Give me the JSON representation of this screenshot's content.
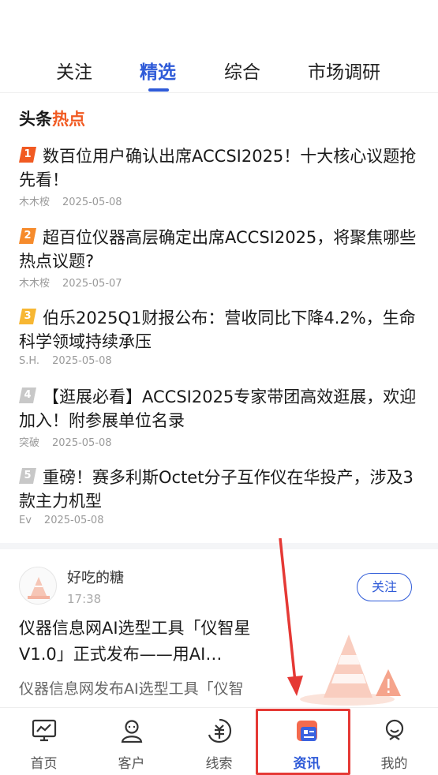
{
  "tabs": [
    {
      "label": "关注"
    },
    {
      "label": "精选",
      "active": true
    },
    {
      "label": "综合"
    },
    {
      "label": "市场调研"
    }
  ],
  "hot": {
    "title_main": "头条",
    "title_accent": "热点",
    "items": [
      {
        "rank": "1",
        "rank_color": "#f15a22",
        "headline": "数百位用户确认出席ACCSI2025！十大核心议题抢先看！",
        "author": "木木桉",
        "date": "2025-05-08"
      },
      {
        "rank": "2",
        "rank_color": "#f68b2c",
        "headline": "超百位仪器高层确定出席ACCSI2025，将聚焦哪些热点议题?",
        "author": "木木桉",
        "date": "2025-05-07"
      },
      {
        "rank": "3",
        "rank_color": "#f7b733",
        "headline": "伯乐2025Q1财报公布：营收同比下降4.2%，生命科学领域持续承压",
        "author": "S.H.",
        "date": "2025-05-08"
      },
      {
        "rank": "4",
        "rank_color": "#c8c8c8",
        "headline": "【逛展必看】ACCSI2025专家带团高效逛展，欢迎加入！附参展单位名录",
        "author": "突破",
        "date": "2025-05-08"
      },
      {
        "rank": "5",
        "rank_color": "#c8c8c8",
        "headline": "重磅！赛多利斯Octet分子互作仪在华投产，涉及3款主力机型",
        "author": "Ev",
        "date": "2025-05-08"
      }
    ]
  },
  "post": {
    "author": "好吃的糖",
    "time": "17:38",
    "follow_label": "关注",
    "title": "仪器信息网AI选型工具「仪智星V1.0」正式发布——用AI…",
    "summary": "仪器信息网发布AI选型工具「仪智"
  },
  "nav": [
    {
      "label": "首页",
      "icon": "home-chart-icon"
    },
    {
      "label": "客户",
      "icon": "customer-icon"
    },
    {
      "label": "线索",
      "icon": "leads-icon"
    },
    {
      "label": "资讯",
      "icon": "news-icon",
      "active": true
    },
    {
      "label": "我的",
      "icon": "profile-icon"
    }
  ],
  "colors": {
    "accent": "#2f5bd8",
    "hot_accent": "#f15a22",
    "highlight": "#e53935"
  }
}
